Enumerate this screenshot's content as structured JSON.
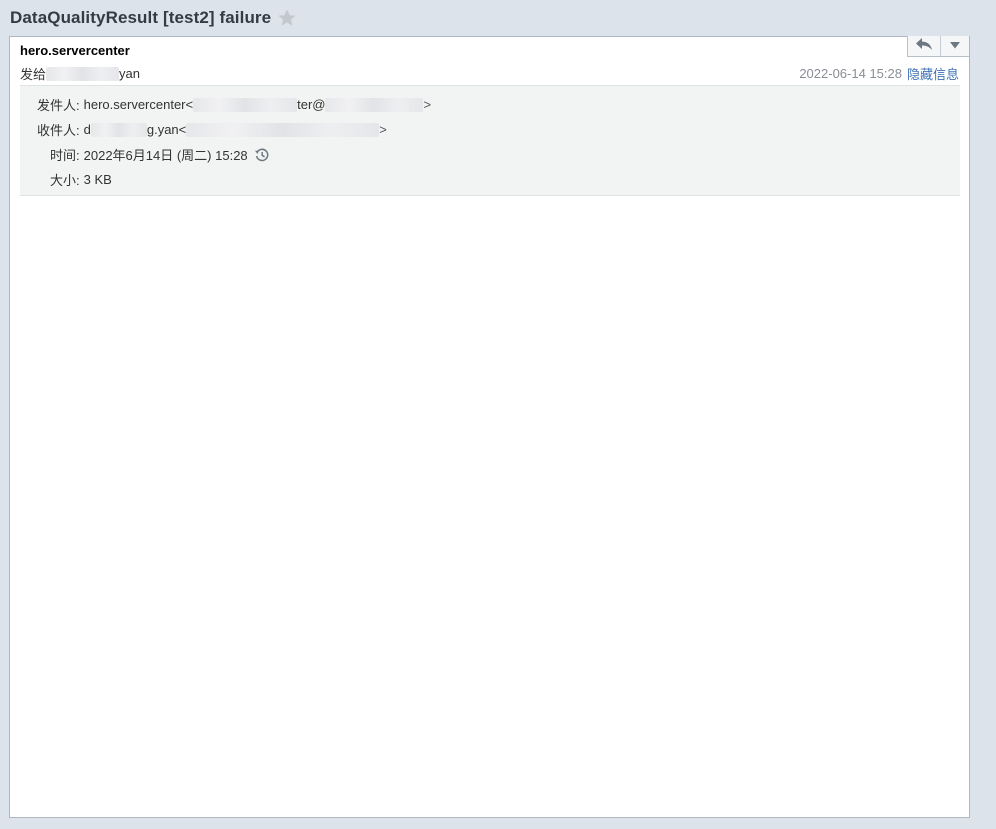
{
  "subject": "DataQualityResult [test2] failure",
  "sender": {
    "name": "hero.servercenter"
  },
  "recipient_line": {
    "prefix": "发给",
    "name_suffix": "yan"
  },
  "header_right": {
    "date": "2022-06-14 15:28",
    "hide_info": "隐藏信息"
  },
  "details": {
    "from_label": "发件人:",
    "from_name": "hero.servercenter<",
    "from_mid": "ter@",
    "from_close": ">",
    "to_label": "收件人:",
    "to_start": "d",
    "to_mid": "g.yan<",
    "to_close": ">",
    "time_label": "时间:",
    "time_value": "2022年6月14日 (周二) 15:28",
    "size_label": "大小:",
    "size_value": "3 KB"
  },
  "icons": {
    "star": "star-icon",
    "reply": "reply-icon",
    "more": "chevron-down-icon",
    "history": "clock-history-icon"
  },
  "colors": {
    "link": "#3f72b5",
    "detail_bg": "#f1f4f3",
    "page_bg": "#dde3ea"
  }
}
